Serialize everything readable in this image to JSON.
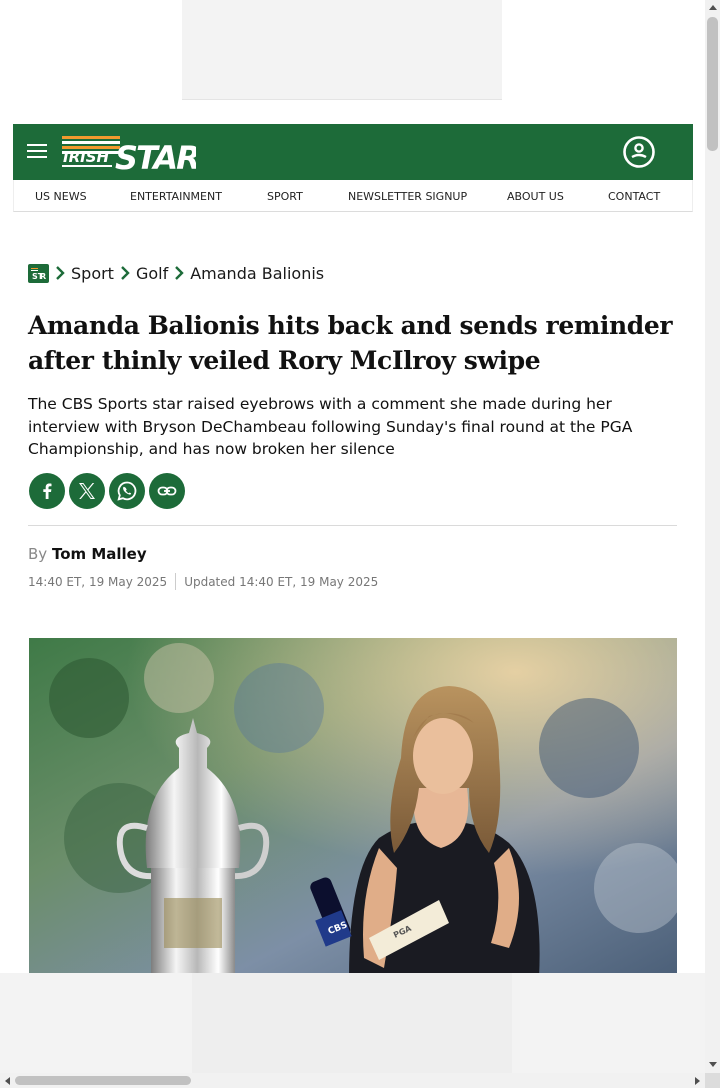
{
  "site": {
    "logo_alt": "Irish Star",
    "logo_word_1": "IRISH",
    "logo_word_2": "STAR",
    "brand_color": "#1d6b39"
  },
  "header": {
    "menu_icon": "hamburger-menu-icon",
    "account_icon": "user-account-icon"
  },
  "nav": {
    "items": [
      {
        "label": "US NEWS"
      },
      {
        "label": "ENTERTAINMENT"
      },
      {
        "label": "SPORT"
      },
      {
        "label": "NEWSLETTER SIGNUP"
      },
      {
        "label": "ABOUT US"
      },
      {
        "label": "CONTACT"
      }
    ]
  },
  "breadcrumb": {
    "items": [
      {
        "label": "Sport"
      },
      {
        "label": "Golf"
      },
      {
        "label": "Amanda Balionis"
      }
    ]
  },
  "article": {
    "headline": "Amanda Balionis hits back and sends reminder after thinly veiled Rory McIlroy swipe",
    "standfirst": "The CBS Sports star raised eyebrows with a comment she made during her interview with Bryson DeChambeau following Sunday's final round at the PGA Championship, and has now broken her silence",
    "byline_prefix": "By",
    "author": "Tom Malley",
    "published": "14:40 ET, 19 May 2025",
    "updated": "Updated 14:40 ET, 19 May 2025"
  },
  "share": [
    {
      "icon": "facebook-icon",
      "color": "#1877f2"
    },
    {
      "icon": "x-icon",
      "color": "#000000"
    },
    {
      "icon": "whatsapp-icon",
      "color": "#25d366"
    },
    {
      "icon": "copy-link-icon",
      "color": "#1d6b39"
    }
  ],
  "hero_image": {
    "mic_text": "CBS",
    "card_text": "PGA"
  }
}
